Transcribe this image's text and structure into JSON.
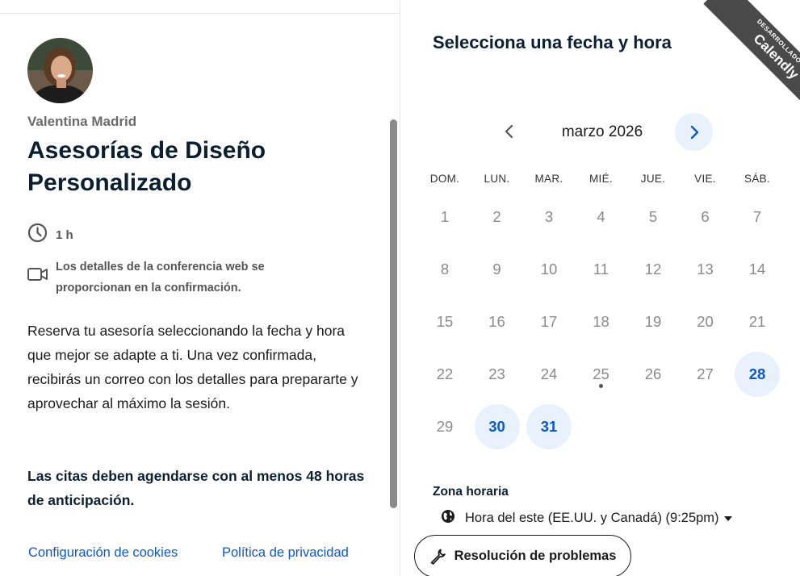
{
  "host": {
    "name": "Valentina Madrid"
  },
  "event": {
    "title": "Asesorías de Diseño Personalizado",
    "duration": "1 h",
    "conference_note": "Los detalles de la conferencia web se proporcionan en la confirmación.",
    "description": "Reserva tu asesoría seleccionando la fecha y hora que mejor se adapte a ti. Una vez confirmada, recibirás un correo con los detalles para prepararte y aprovechar al máximo la sesión.",
    "note": "Las citas deben agendarse con al menos 48 horas de anticipación."
  },
  "footer": {
    "cookies_link": "Configuración de cookies",
    "privacy_link": "Política de privacidad"
  },
  "calendar": {
    "heading": "Selecciona una fecha y hora",
    "month": "marzo 2026",
    "weekdays": [
      "DOM.",
      "LUN.",
      "MAR.",
      "MIÉ.",
      "JUE.",
      "VIE.",
      "SÁB."
    ],
    "start_weekday_index": 0,
    "days_in_month": 31,
    "available_days": [
      28,
      30,
      31
    ],
    "today": 25
  },
  "timezone": {
    "label": "Zona horaria",
    "value": "Hora del este (EE.UU. y Canadá) (9:25pm)"
  },
  "troubleshoot": {
    "label": "Resolución de problemas"
  },
  "badge": {
    "small_text": "DESARROLLADO POR",
    "brand": "Calendly"
  },
  "colors": {
    "accent": "#0b59c8",
    "available_bg": "#e9f1fd",
    "heading": "#0b1f33",
    "muted": "#8a8a8a"
  }
}
